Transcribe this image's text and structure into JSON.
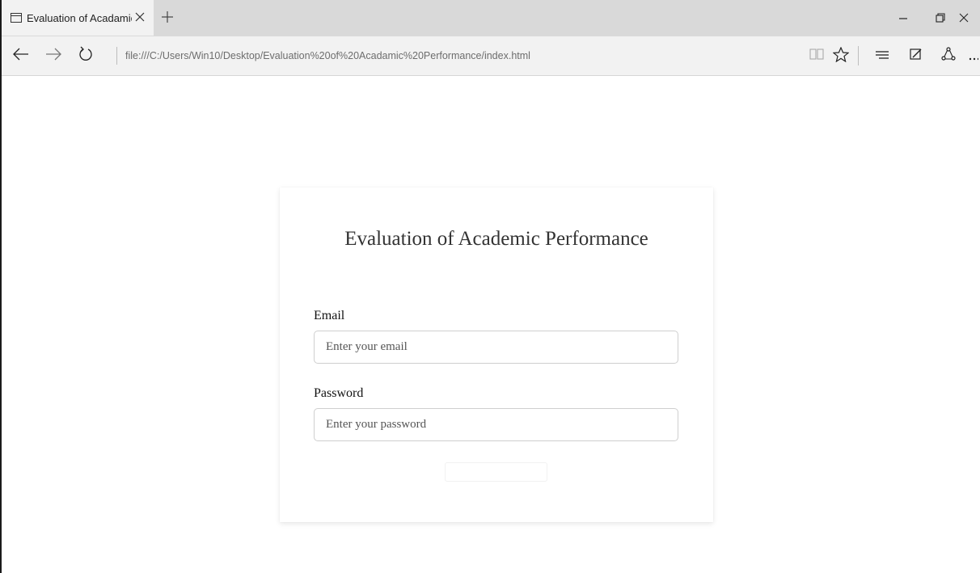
{
  "browser": {
    "tab_title": "Evaluation of Acadamic I",
    "address": "file:///C:/Users/Win10/Desktop/Evaluation%20of%20Acadamic%20Performance/index.html"
  },
  "login": {
    "title": "Evaluation of Academic Performance",
    "email_label": "Email",
    "email_placeholder": "Enter your email",
    "password_label": "Password",
    "password_placeholder": "Enter your password",
    "submit_label": ""
  },
  "icons": {
    "tab": "tab-page-icon",
    "close": "close-icon",
    "new_tab": "plus-icon",
    "back": "back-arrow-icon",
    "forward": "forward-arrow-icon",
    "refresh": "refresh-icon",
    "reading_view": "book-icon",
    "favorite": "star-icon",
    "hub": "hub-lines-icon",
    "note": "pen-note-icon",
    "share": "share-icon",
    "more": "more-icon"
  },
  "colors": {
    "tab_bar": "#d9d9d9",
    "toolbar": "#f2f2f2",
    "title_text": "#333333"
  }
}
